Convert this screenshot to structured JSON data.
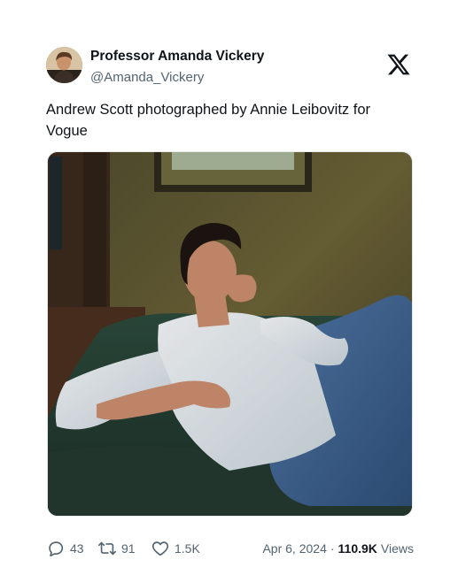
{
  "author": {
    "display_name": "Professor Amanda Vickery",
    "handle": "@Amanda_Vickery",
    "avatar_icon": "profile-photo"
  },
  "platform": {
    "logo_icon": "x-logo-icon"
  },
  "tweet": {
    "text": "Andrew Scott photographed by Annie Leibovitz for Vogue"
  },
  "media": {
    "type": "photo"
  },
  "engagement": {
    "replies": "43",
    "retweets": "91",
    "likes": "1.5K"
  },
  "meta": {
    "date": "Apr 6, 2024",
    "separator": "·",
    "views_count": "110.9K",
    "views_label": "Views"
  },
  "colors": {
    "text_primary": "#0f1419",
    "text_secondary": "#536471"
  }
}
